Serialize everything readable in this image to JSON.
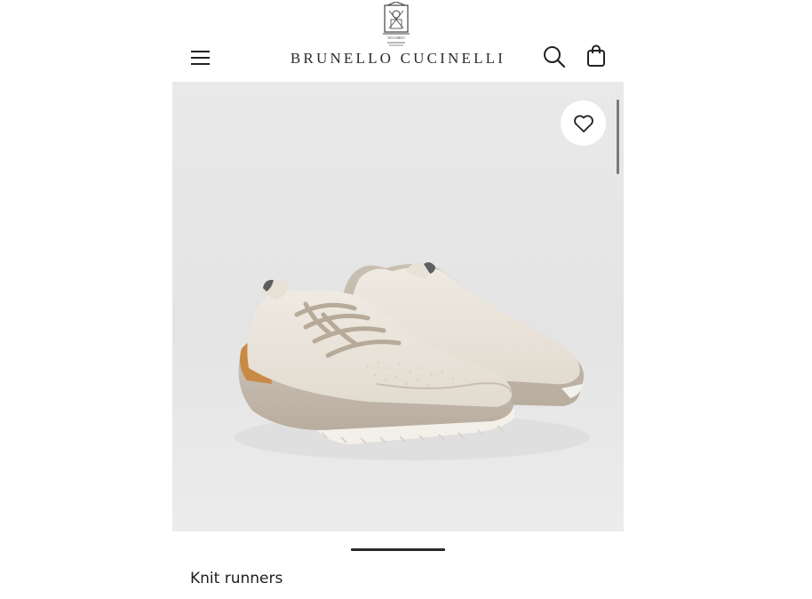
{
  "header": {
    "brand_name": "BRUNELLO CUCINELLI",
    "crest_text": "SOLOMEO",
    "menu_icon": "hamburger-menu-icon",
    "search_icon": "search-icon",
    "bag_icon": "shopping-bag-icon"
  },
  "gallery": {
    "favorite_icon": "heart-icon",
    "image_subject": "knit-runner-sneakers"
  },
  "product": {
    "name": "Knit runners"
  },
  "colors": {
    "background": "#ffffff",
    "image_background": "#e7e7e7",
    "text_primary": "#1e1e1e",
    "indicator": "#2a2a2a"
  }
}
